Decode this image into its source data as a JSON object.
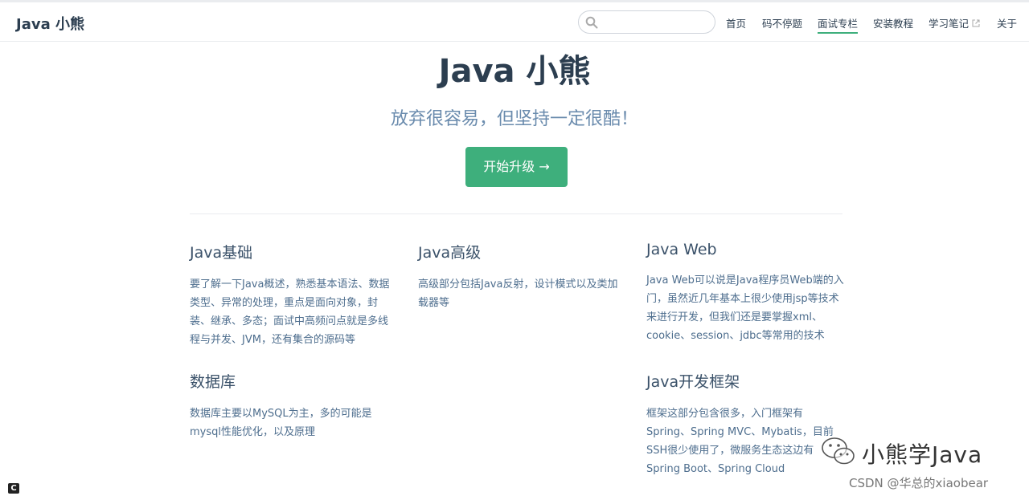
{
  "navbar": {
    "site_name": "Java 小熊",
    "search": {
      "value": "",
      "placeholder": ""
    },
    "links": [
      {
        "label": "首页"
      },
      {
        "label": "码不停题"
      },
      {
        "label": "面试专栏",
        "active": true
      },
      {
        "label": "安装教程"
      },
      {
        "label": "学习笔记",
        "external": true
      },
      {
        "label": "关于"
      }
    ]
  },
  "hero": {
    "title": "Java 小熊",
    "description": "放弃很容易，但坚持一定很酷！",
    "action_label": "开始升级 →"
  },
  "features": [
    {
      "title": "Java基础",
      "details": "要了解一下Java概述，熟悉基本语法、数据类型、异常的处理，重点是面向对象，封装、继承、多态；面试中高频问点就是多线程与并发、JVM，还有集合的源码等"
    },
    {
      "title": "Java高级",
      "details": "高级部分包括Java反射，设计模式以及类加载器等"
    },
    {
      "title": "Java Web",
      "details": "Java Web可以说是Java程序员Web端的入门，虽然近几年基本上很少使用jsp等技术来进行开发，但我们还是要掌握xml、cookie、session、jdbc等常用的技术"
    },
    {
      "title": "数据库",
      "details": "数据库主要以MySQL为主，多的可能是mysql性能优化，以及原理"
    },
    {
      "title": "Java开发框架",
      "details": "框架这部分包含很多，入门框架有Spring、Spring MVC、Mybatis，目前SSH很少使用了，微服务生态这边有Spring Boot、Spring Cloud"
    }
  ],
  "watermark": {
    "brand": "小熊学Java",
    "csdn": "CSDN @华总的xiaobear"
  },
  "corner_badge": "C",
  "colors": {
    "accent": "#3eaf7c",
    "text": "#2c3e50",
    "description": "#6a8bad"
  }
}
